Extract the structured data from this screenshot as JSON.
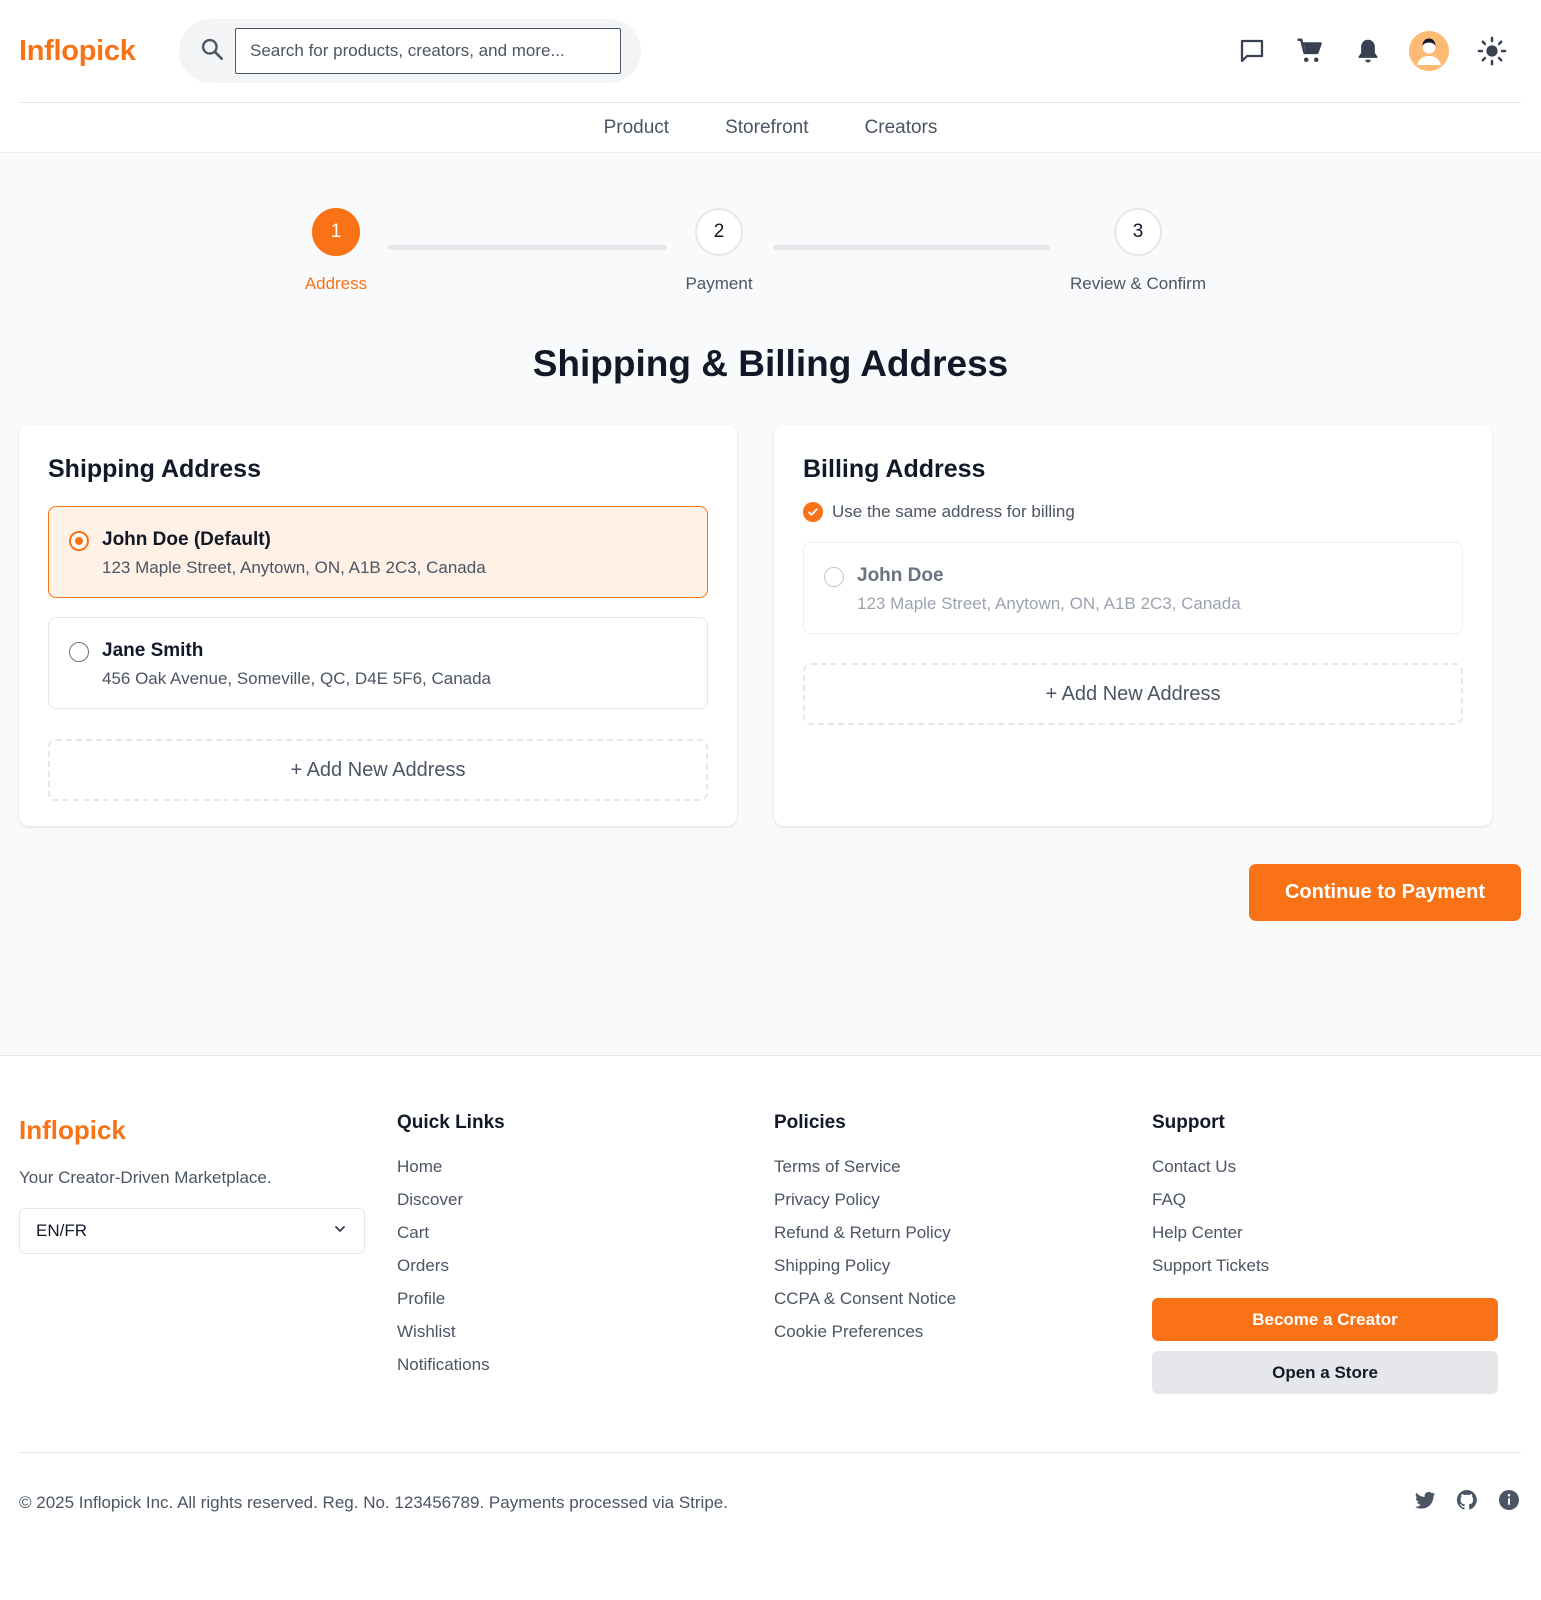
{
  "header": {
    "logo": "Inflopick",
    "search": {
      "placeholder": "Search for products, creators, and more..."
    },
    "icons": [
      "chat-icon",
      "cart-icon",
      "bell-icon",
      "avatar",
      "sun-icon"
    ]
  },
  "nav": {
    "items": [
      "Product",
      "Storefront",
      "Creators"
    ]
  },
  "stepper": {
    "current": 1,
    "steps": [
      {
        "number": "1",
        "label": "Address"
      },
      {
        "number": "2",
        "label": "Payment"
      },
      {
        "number": "3",
        "label": "Review & Confirm"
      }
    ]
  },
  "page": {
    "title": "Shipping & Billing Address"
  },
  "shipping": {
    "title": "Shipping Address",
    "addresses": [
      {
        "name": "John Doe (Default)",
        "line": "123 Maple Street, Anytown, ON, A1B 2C3, Canada",
        "selected": true
      },
      {
        "name": "Jane Smith",
        "line": "456 Oak Avenue, Someville, QC, D4E 5F6, Canada",
        "selected": false
      }
    ],
    "add_label": "+ Add New Address"
  },
  "billing": {
    "title": "Billing Address",
    "same_label": "Use the same address for billing",
    "same_checked": true,
    "address": {
      "name": "John Doe",
      "line": "123 Maple Street, Anytown, ON, A1B 2C3, Canada"
    },
    "add_label": "+ Add New Address"
  },
  "continue_label": "Continue to Payment",
  "footer": {
    "logo": "Inflopick",
    "tagline": "Your Creator-Driven Marketplace.",
    "language": "EN/FR",
    "quick_links": {
      "title": "Quick Links",
      "items": [
        "Home",
        "Discover",
        "Cart",
        "Orders",
        "Profile",
        "Wishlist",
        "Notifications"
      ]
    },
    "policies": {
      "title": "Policies",
      "items": [
        "Terms of Service",
        "Privacy Policy",
        "Refund & Return Policy",
        "Shipping Policy",
        "CCPA & Consent Notice",
        "Cookie Preferences"
      ]
    },
    "support": {
      "title": "Support",
      "items": [
        "Contact Us",
        "FAQ",
        "Help Center",
        "Support Tickets"
      ],
      "creator_button": "Become a Creator",
      "store_button": "Open a Store"
    },
    "copyright": "© 2025 Inflopick Inc. All rights reserved. Reg. No. 123456789. Payments processed via Stripe.",
    "social_icons": [
      "twitter-icon",
      "github-icon",
      "info-icon"
    ]
  },
  "colors": {
    "accent": "#f97316",
    "accent_light": "#fff1e6",
    "text": "#111827",
    "muted": "#4b5563"
  }
}
